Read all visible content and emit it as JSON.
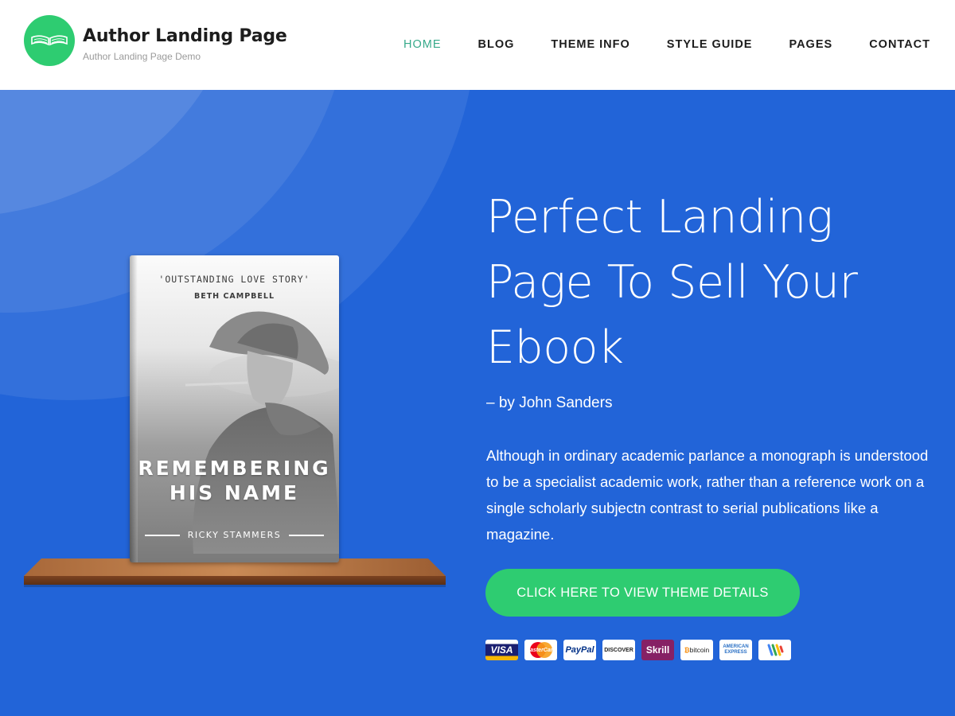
{
  "header": {
    "site_title": "Author Landing Page",
    "tagline": "Author Landing Page Demo",
    "logo_icon": "open-book-icon",
    "nav": [
      {
        "label": "HOME",
        "active": true
      },
      {
        "label": "BLOG",
        "active": false
      },
      {
        "label": "THEME INFO",
        "active": false
      },
      {
        "label": "STYLE GUIDE",
        "active": false
      },
      {
        "label": "PAGES",
        "active": false
      },
      {
        "label": "CONTACT",
        "active": false
      }
    ]
  },
  "book": {
    "quote": "'OUTSTANDING LOVE STORY'",
    "cover_author": "BETH CAMPBELL",
    "title_line1": "REMEMBERING",
    "title_line2": "HIS NAME",
    "byline": "RICKY STAMMERS"
  },
  "hero": {
    "title": "Perfect Landing Page To Sell Your Ebook",
    "by": "– by John Sanders",
    "description": "Although in ordinary academic parlance a monograph is understood to be a specialist academic work, rather than a reference work on a single scholarly subjectn contrast to serial publications like a magazine.",
    "cta": "CLICK HERE TO VIEW THEME DETAILS"
  },
  "payments": {
    "visa": "VISA",
    "mastercard": "MasterCard",
    "paypal": "PayPal",
    "discover": "DISCOVER",
    "skrill": "Skrill",
    "bitcoin": "bitcoin",
    "amex_line1": "AMERICAN",
    "amex_line2": "EXPRESS"
  },
  "colors": {
    "hero_bg": "#2264d8",
    "accent_green": "#2ecc71",
    "nav_active": "#36a98a"
  }
}
